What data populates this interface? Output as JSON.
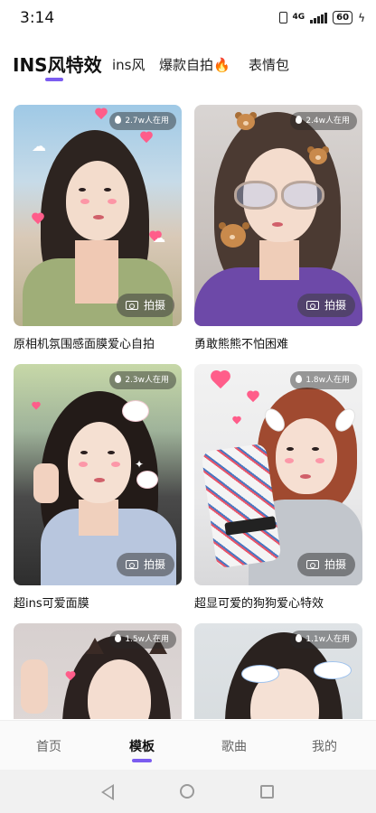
{
  "status_bar": {
    "time": "3:14",
    "network": "4G",
    "battery": "60"
  },
  "tabs": [
    {
      "label": "INS风特效",
      "selected": true
    },
    {
      "label": "ins风",
      "selected": false
    },
    {
      "label": "爆款自拍🔥",
      "selected": false
    },
    {
      "label": "表情包",
      "selected": false
    }
  ],
  "cards": [
    {
      "users": "2.7w人在用",
      "shoot_label": "拍摄",
      "title": "原相机氛围感面膜爱心自拍"
    },
    {
      "users": "2.4w人在用",
      "shoot_label": "拍摄",
      "title": "勇敢熊熊不怕困难"
    },
    {
      "users": "2.3w人在用",
      "shoot_label": "拍摄",
      "title": "超ins可爱面膜"
    },
    {
      "users": "1.8w人在用",
      "shoot_label": "拍摄",
      "title": "超显可爱的狗狗爱心特效"
    },
    {
      "users": "1.5w人在用"
    },
    {
      "users": "1.1w人在用"
    }
  ],
  "bottom_nav": [
    {
      "label": "首页",
      "selected": false
    },
    {
      "label": "模板",
      "selected": true
    },
    {
      "label": "歌曲",
      "selected": false
    },
    {
      "label": "我的",
      "selected": false
    }
  ],
  "colors": {
    "accent": "#7b5cf0"
  }
}
